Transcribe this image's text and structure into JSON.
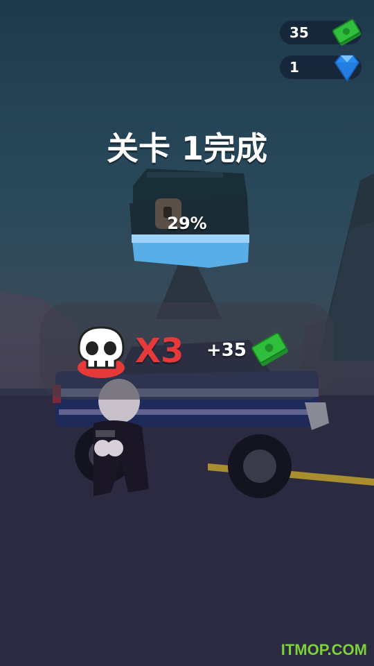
{
  "hud": {
    "cash_count": "35",
    "gem_count": "1",
    "cash_icon": "cash-stack-icon",
    "gem_icon": "diamond-icon"
  },
  "level": {
    "title": "关卡 1完成"
  },
  "chest": {
    "progress_label": "29%",
    "progress": 0.29
  },
  "reward": {
    "multiplier": "X3",
    "cash_bonus": "+35",
    "skull_icon": "skull-icon"
  },
  "watermark": "ITMOP.COM",
  "colors": {
    "multiplier": "#e63a3a",
    "cash_green": "#2fbf3c",
    "gem_blue": "#2a8cf0",
    "watermark": "#7bd23a"
  }
}
